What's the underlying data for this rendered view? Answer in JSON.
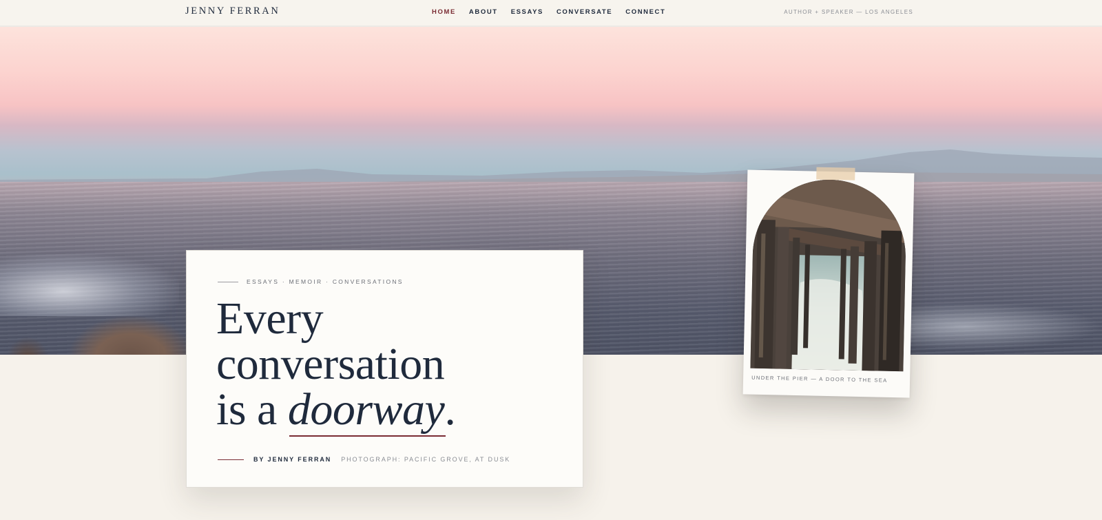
{
  "header": {
    "brand": "JENNY FERRAN",
    "nav": [
      {
        "label": "HOME",
        "active": true
      },
      {
        "label": "ABOUT",
        "active": false
      },
      {
        "label": "ESSAYS",
        "active": false
      },
      {
        "label": "CONVERSATE",
        "active": false
      },
      {
        "label": "CONNECT",
        "active": false
      }
    ],
    "tagline": "AUTHOR + SPEAKER — LOS ANGELES"
  },
  "hero_card": {
    "eyebrow": "ESSAYS · MEMOIR · CONVERSATIONS",
    "headline_line1": "Every",
    "headline_line2": "conversation",
    "headline_line3_prefix": "is a ",
    "headline_emphasis": "doorway",
    "headline_suffix": ".",
    "byline": "BY JENNY FERRAN",
    "photo_credit": "PHOTOGRAPH: PACIFIC GROVE, AT DUSK"
  },
  "polaroid": {
    "caption": "UNDER THE PIER — A DOOR TO THE SEA"
  },
  "colors": {
    "accent": "#7a2b33",
    "ink": "#1f2a3c",
    "background": "#f6f2eb",
    "card": "#fdfcf9"
  }
}
